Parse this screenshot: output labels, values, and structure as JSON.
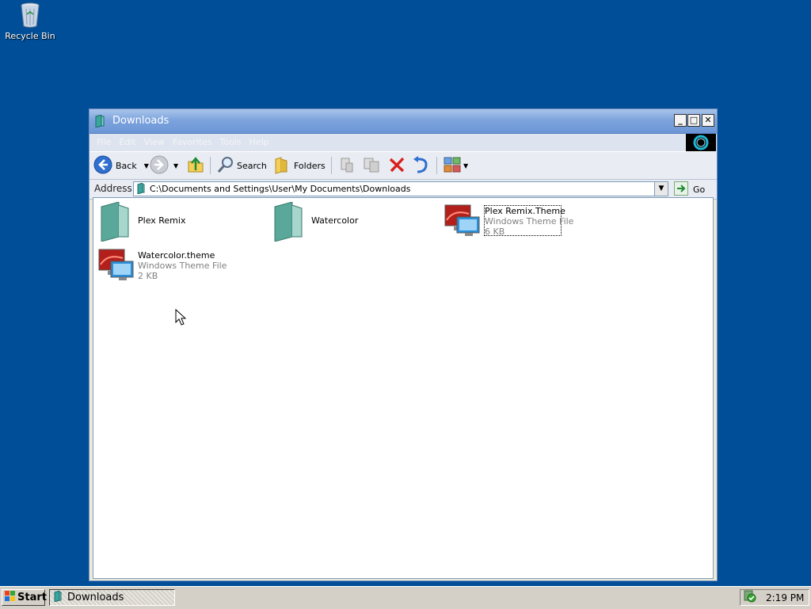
{
  "desktop": {
    "icons": [
      {
        "label": "Recycle Bin",
        "icon": "recycle-bin-icon"
      }
    ]
  },
  "window": {
    "title": "Downloads",
    "controls": {
      "minimize": "_",
      "maximize": "□",
      "close": "✕"
    },
    "menu": [
      "File",
      "Edit",
      "View",
      "Favorites",
      "Tools",
      "Help"
    ],
    "toolbar": {
      "back_label": "Back",
      "search_label": "Search",
      "folders_label": "Folders"
    },
    "address": {
      "label": "Address",
      "value": "C:\\Documents and Settings\\User\\My Documents\\Downloads",
      "go_label": "Go"
    },
    "items": [
      {
        "name": "Plex Remix",
        "kind": "folder"
      },
      {
        "name": "Watercolor",
        "kind": "folder"
      },
      {
        "name": "Plex Remix.Theme",
        "type": "Windows Theme File",
        "size": "6 KB",
        "kind": "theme",
        "selected": true
      },
      {
        "name": "Watercolor.theme",
        "type": "Windows Theme File",
        "size": "2 KB",
        "kind": "theme"
      }
    ]
  },
  "taskbar": {
    "start_label": "Start",
    "task_label": "Downloads",
    "clock": "2:19 PM"
  },
  "colors": {
    "desktop": "#004e98",
    "titlebar": "#7da4dd"
  }
}
